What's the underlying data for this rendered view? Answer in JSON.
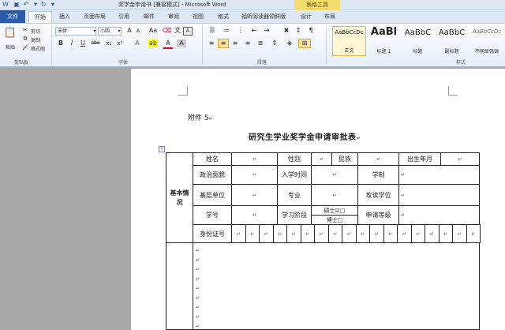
{
  "window": {
    "title": "奖学金申请书 [兼容模式] - Microsoft Word",
    "context_tab": "表格工具"
  },
  "tabs": {
    "file": "文件",
    "home": "开始",
    "items": [
      "插入",
      "页面布局",
      "引用",
      "邮件",
      "审阅",
      "视图",
      "格式",
      "福昕阅读器领鲜版",
      "设计",
      "布局"
    ]
  },
  "clipboard": {
    "paste": "粘贴",
    "cut": "剪切",
    "copy": "复制",
    "format_painter": "格式刷",
    "group": "剪贴板"
  },
  "font": {
    "name": "宋体",
    "size": "小四",
    "grow": "A",
    "shrink": "A",
    "case": "Aa",
    "wen": "文",
    "bold": "B",
    "italic": "I",
    "underline": "U",
    "strike": "abe",
    "sub": "x₂",
    "sup": "x²",
    "color_a": "A",
    "char_border": "A",
    "group": "字体"
  },
  "paragraph": {
    "group": "段落",
    "sort": "↕",
    "marks": "¶"
  },
  "styles": {
    "group": "样式",
    "items": [
      {
        "preview": "AaBbCcDc",
        "name": "正文",
        "selected": true
      },
      {
        "preview": "AaBl",
        "name": "标题 1"
      },
      {
        "preview": "AaBbC",
        "name": "标题"
      },
      {
        "preview": "AaBbC",
        "name": "副标题"
      },
      {
        "preview": "AaBbCcDc",
        "name": "不明显强调"
      }
    ]
  },
  "document": {
    "attachment": "附件 5",
    "title": "研究生学业奖学金申请审批表",
    "para_mark": "↵",
    "table": {
      "basic_info": "基本情况",
      "name": "姓名",
      "gender": "性别",
      "ethnicity": "民族",
      "birth": "出生年月",
      "political": "政治面貌",
      "enroll_time": "入学时间",
      "school_system": "学制",
      "unit": "基层单位",
      "major": "专业",
      "degree": "攻读学位",
      "student_id": "学号",
      "stage": "学习阶段",
      "master": "硕士☑□",
      "doctor": "博士□",
      "apply_level": "申请等级",
      "id_number": "身份证号"
    }
  }
}
